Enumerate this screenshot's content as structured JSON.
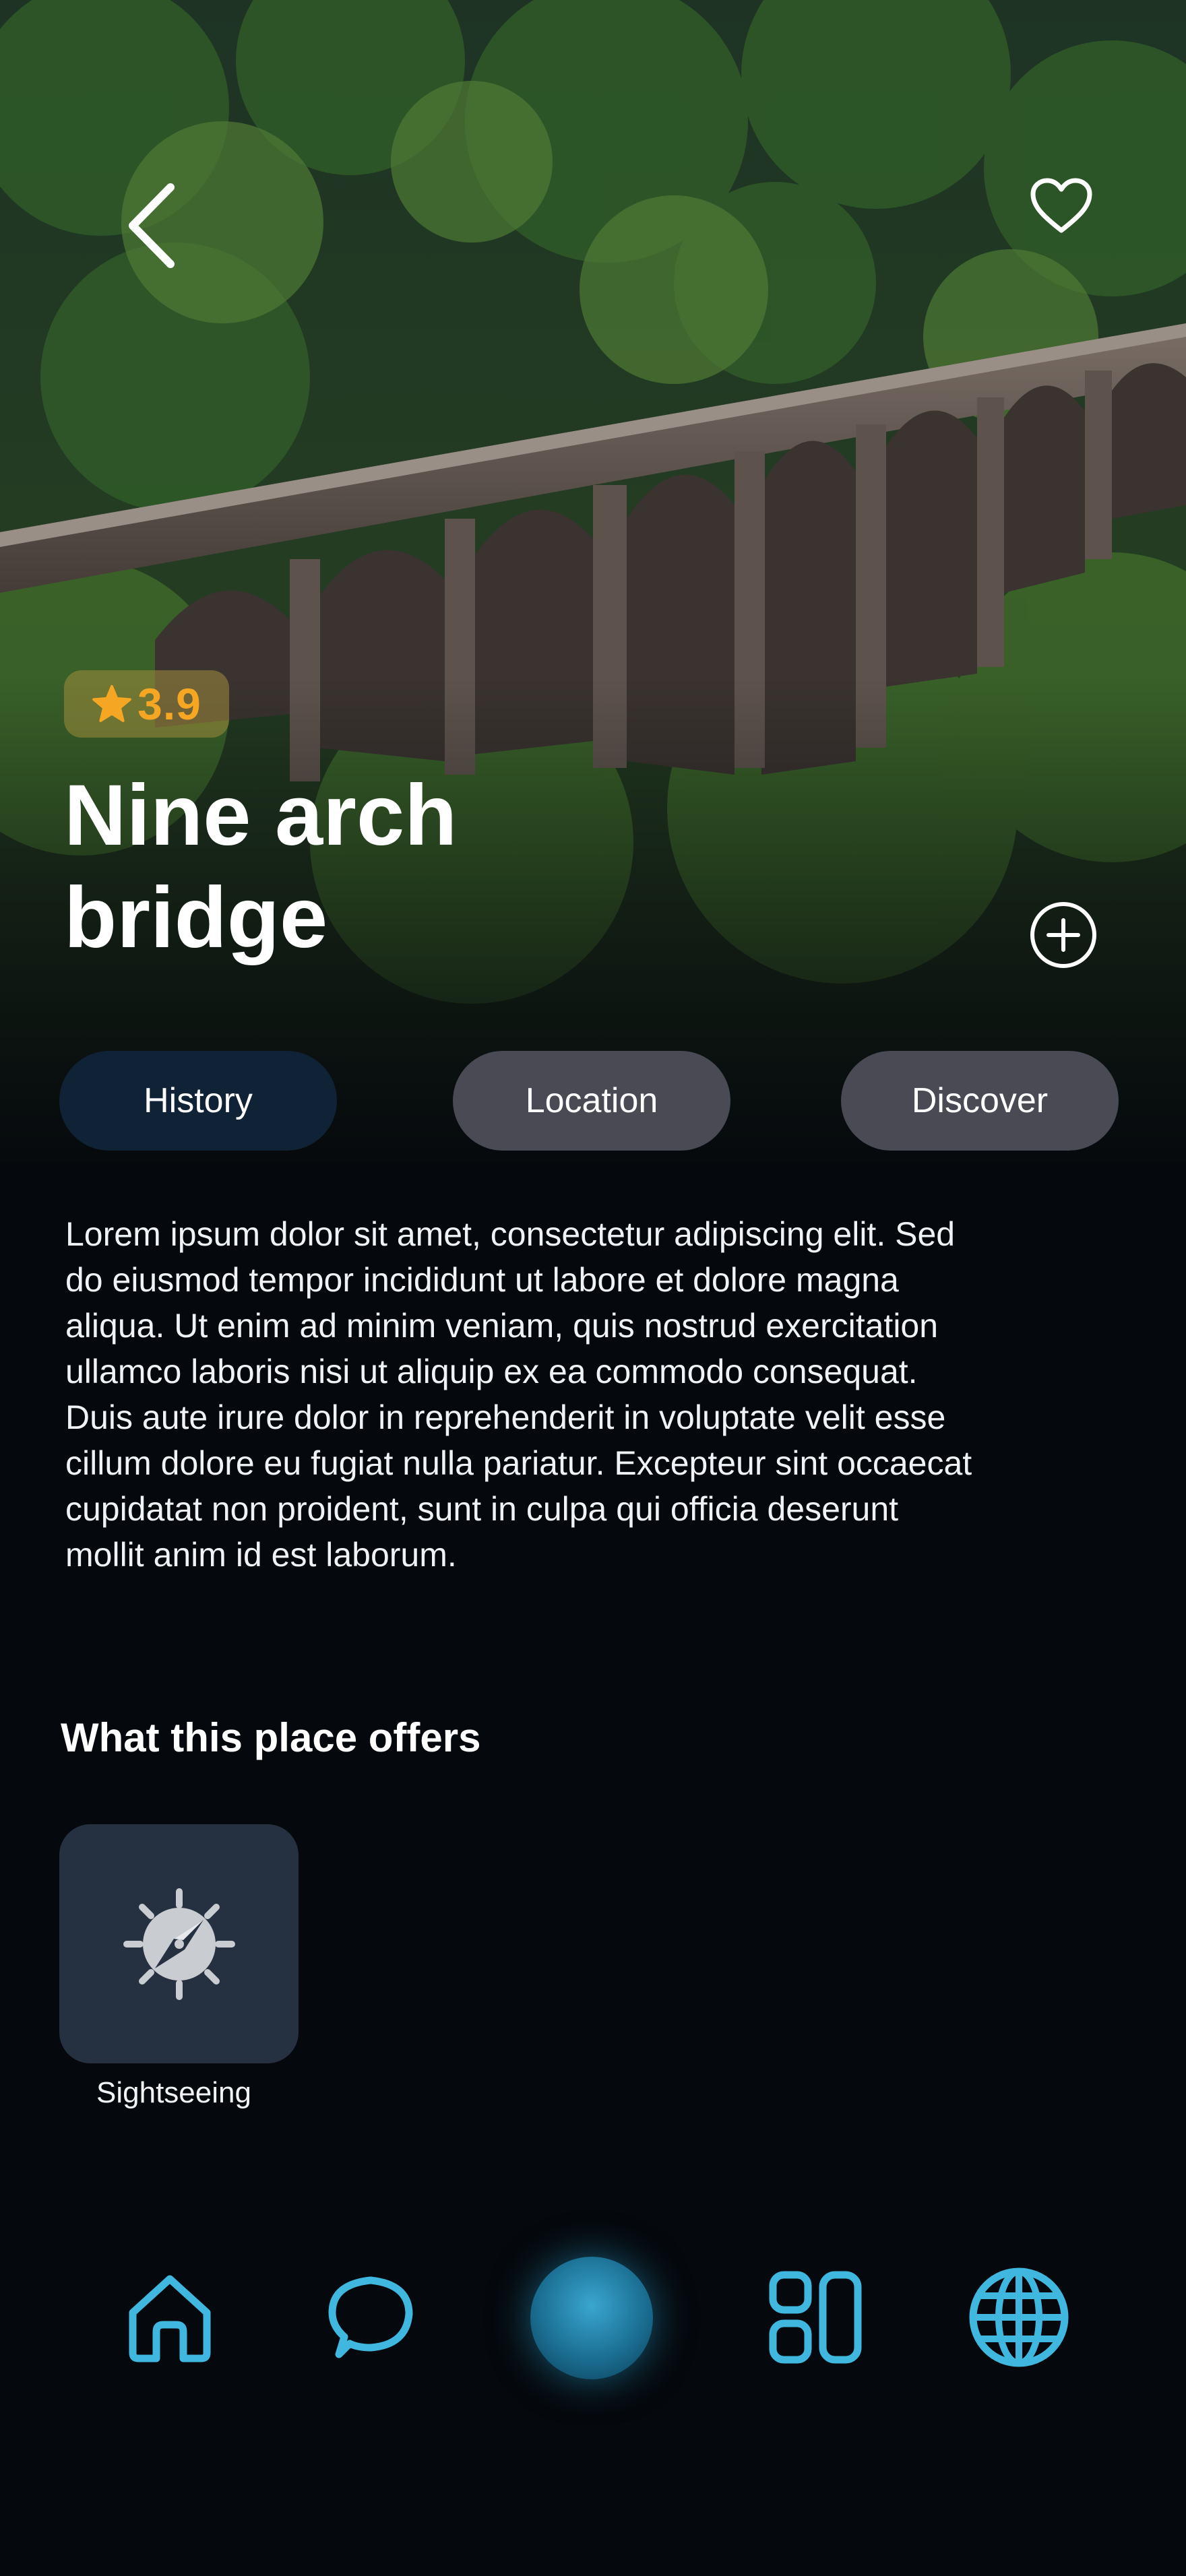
{
  "header": {
    "back_icon": "chevron-left-icon",
    "favorite_icon": "heart-icon",
    "add_icon": "plus-circle-icon"
  },
  "place": {
    "rating": "3.9",
    "rating_icon": "star-icon",
    "title": "Nine arch bridge"
  },
  "tabs": [
    {
      "label": "History",
      "active": true
    },
    {
      "label": "Location",
      "active": false
    },
    {
      "label": "Discover",
      "active": false
    }
  ],
  "description": "Lorem ipsum dolor sit amet, consectetur adipiscing elit. Sed do eiusmod tempor incididunt ut labore et dolore magna aliqua. Ut enim ad minim veniam, quis nostrud exercitation ullamco laboris nisi ut aliquip ex ea commodo consequat. Duis aute irure dolor in reprehenderit in voluptate velit esse cillum dolore eu fugiat nulla pariatur. Excepteur sint occaecat cupidatat non proident, sunt in culpa qui officia deserunt mollit anim id est laborum.",
  "offers": {
    "heading": "What this place offers",
    "items": [
      {
        "label": "Sightseeing",
        "icon": "compass-icon"
      }
    ]
  },
  "nav": {
    "items": [
      {
        "icon": "home-icon"
      },
      {
        "icon": "chat-bubble-icon"
      },
      {
        "icon": "center-orb-button"
      },
      {
        "icon": "apps-grid-icon"
      },
      {
        "icon": "globe-icon"
      }
    ]
  },
  "colors": {
    "background": "#05080c",
    "accent": "#3fb7df",
    "rating": "#f5a623",
    "tab_active": "#102236",
    "tab_inactive": "#4a4a55",
    "card": "#253140"
  }
}
